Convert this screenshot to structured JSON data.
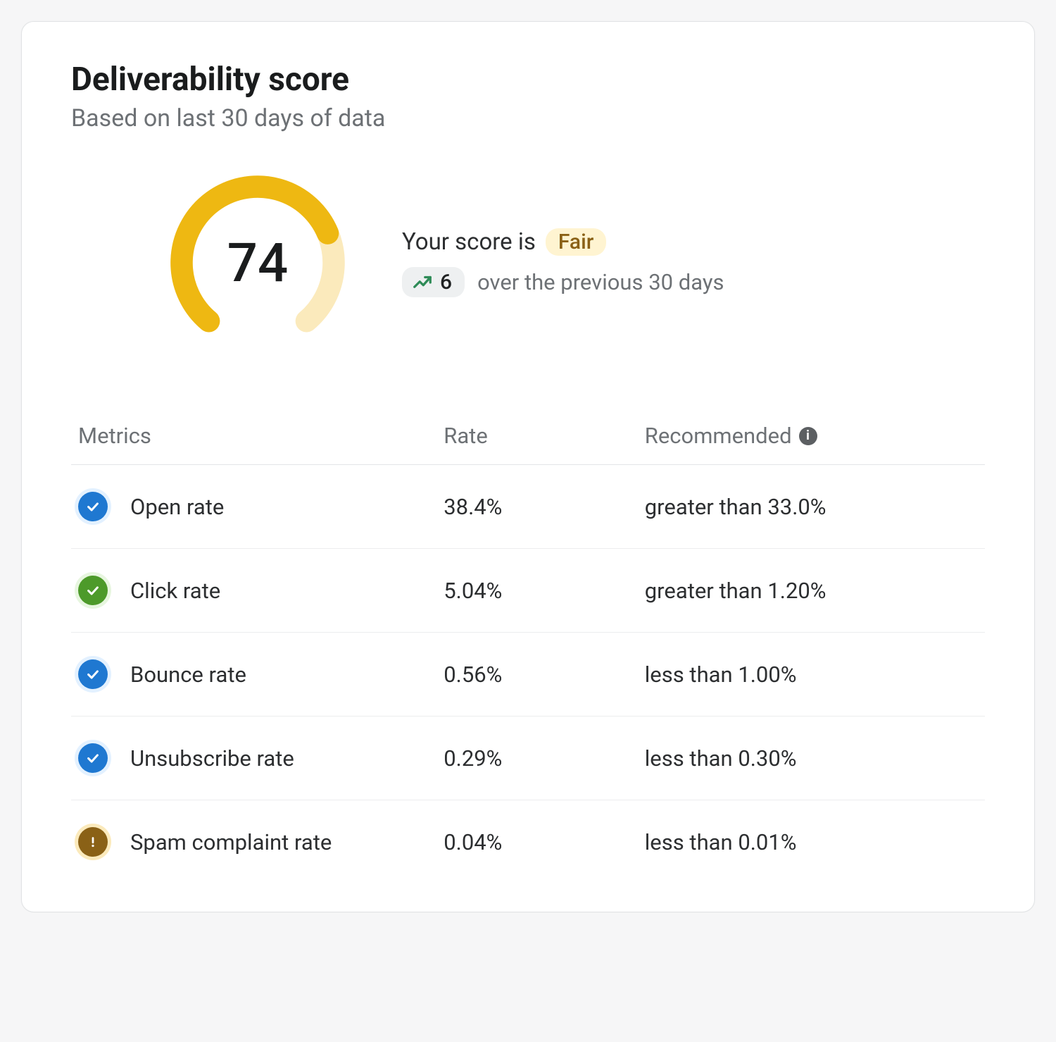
{
  "header": {
    "title": "Deliverability score",
    "subtitle": "Based on last 30 days of data"
  },
  "score": {
    "value": "74",
    "percent": 74,
    "label_prefix": "Your score is",
    "grade": "Fair",
    "delta_value": "6",
    "delta_suffix": "over the previous 30 days"
  },
  "columns": {
    "metrics": "Metrics",
    "rate": "Rate",
    "recommended": "Recommended"
  },
  "rows": [
    {
      "status": "blue",
      "status_icon": "check",
      "name": "Open rate",
      "rate": "38.4%",
      "recommended": "greater than 33.0%"
    },
    {
      "status": "green",
      "status_icon": "check",
      "name": "Click rate",
      "rate": "5.04%",
      "recommended": "greater than 1.20%"
    },
    {
      "status": "blue",
      "status_icon": "check",
      "name": "Bounce rate",
      "rate": "0.56%",
      "recommended": "less than 1.00%"
    },
    {
      "status": "blue",
      "status_icon": "check",
      "name": "Unsubscribe rate",
      "rate": "0.29%",
      "recommended": "less than 0.30%"
    },
    {
      "status": "warn",
      "status_icon": "alert",
      "name": "Spam complaint rate",
      "rate": "0.04%",
      "recommended": "less than 0.01%"
    }
  ],
  "colors": {
    "gauge_fg": "#eeb812",
    "gauge_bg": "#fbeabc"
  },
  "chart_data": {
    "type": "gauge",
    "title": "Deliverability score",
    "value": 74,
    "min": 0,
    "max": 100,
    "grade": "Fair",
    "delta": 6,
    "delta_period": "previous 30 days"
  }
}
